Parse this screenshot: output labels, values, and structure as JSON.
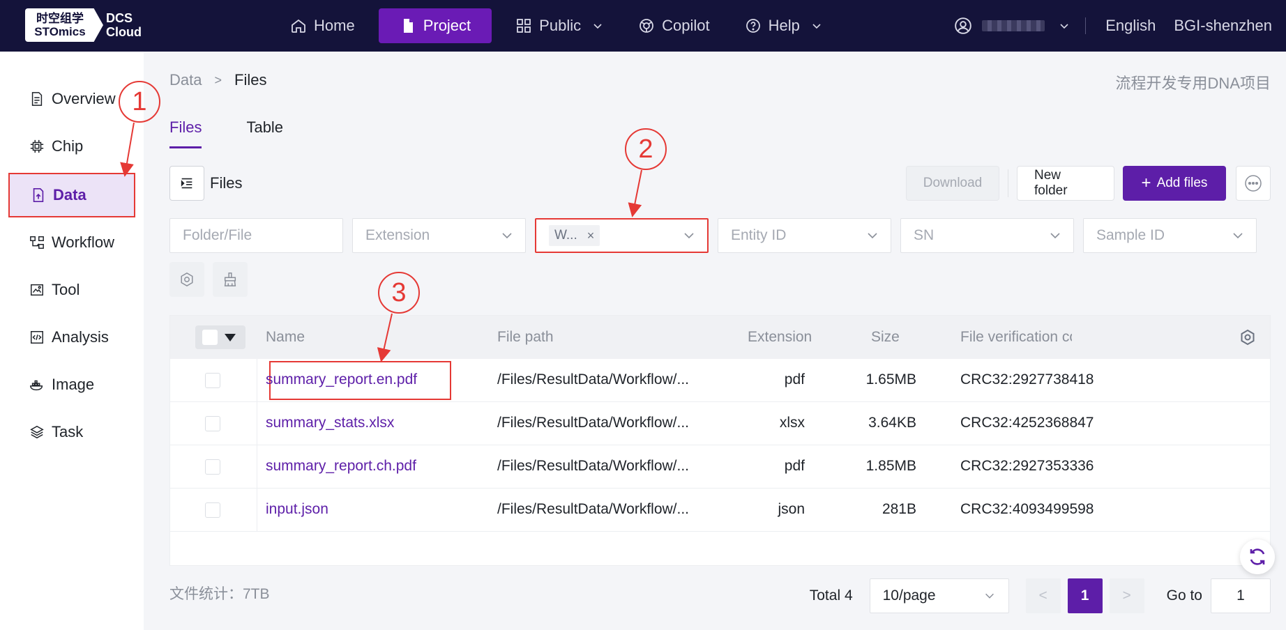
{
  "header": {
    "logo_cn": "时空组学",
    "logo_en": "STOmics",
    "logo_dcs": "DCS",
    "logo_cloud": "Cloud",
    "nav": [
      {
        "label": "Home",
        "icon": "home-icon"
      },
      {
        "label": "Project",
        "icon": "file-icon"
      },
      {
        "label": "Public",
        "icon": "grid-icon"
      },
      {
        "label": "Copilot",
        "icon": "copilot-icon"
      },
      {
        "label": "Help",
        "icon": "help-icon"
      }
    ],
    "language": "English",
    "organization": "BGI-shenzhen"
  },
  "sidebar": {
    "items": [
      {
        "label": "Overview",
        "icon": "document-icon"
      },
      {
        "label": "Chip",
        "icon": "chip-icon"
      },
      {
        "label": "Data",
        "icon": "data-icon"
      },
      {
        "label": "Workflow",
        "icon": "workflow-icon"
      },
      {
        "label": "Tool",
        "icon": "tool-icon"
      },
      {
        "label": "Analysis",
        "icon": "analysis-icon"
      },
      {
        "label": "Image",
        "icon": "image-icon"
      },
      {
        "label": "Task",
        "icon": "layers-icon"
      }
    ]
  },
  "breadcrumb": {
    "parent": "Data",
    "separator": ">",
    "current": "Files"
  },
  "project_name": "流程开发专用DNA项目",
  "tabs": [
    {
      "label": "Files"
    },
    {
      "label": "Table"
    }
  ],
  "toolbar": {
    "files_label": "Files",
    "download": "Download",
    "new_folder": "New folder",
    "add_files": "Add files",
    "plus": "+"
  },
  "filters": {
    "folder_file_placeholder": "Folder/File",
    "extension_placeholder": "Extension",
    "selected_tag": "W...",
    "tag_close": "×",
    "entity_id_placeholder": "Entity ID",
    "sn_placeholder": "SN",
    "sample_id_placeholder": "Sample ID"
  },
  "table": {
    "headers": {
      "name": "Name",
      "path": "File path",
      "extension": "Extension",
      "size": "Size",
      "checksum": "File verification cod"
    },
    "rows": [
      {
        "name": "summary_report.en.pdf",
        "path": "/Files/ResultData/Workflow/...",
        "extension": "pdf",
        "size": "1.65MB",
        "checksum": "CRC32:2927738418"
      },
      {
        "name": "summary_stats.xlsx",
        "path": "/Files/ResultData/Workflow/...",
        "extension": "xlsx",
        "size": "3.64KB",
        "checksum": "CRC32:4252368847"
      },
      {
        "name": "summary_report.ch.pdf",
        "path": "/Files/ResultData/Workflow/...",
        "extension": "pdf",
        "size": "1.85MB",
        "checksum": "CRC32:2927353336"
      },
      {
        "name": "input.json",
        "path": "/Files/ResultData/Workflow/...",
        "extension": "json",
        "size": "281B",
        "checksum": "CRC32:4093499598"
      }
    ]
  },
  "footer": {
    "stats": "文件统计：7TB",
    "total": "Total 4",
    "page_size": "10/page",
    "prev": "<",
    "current_page": "1",
    "next": ">",
    "goto_label": "Go to",
    "goto_value": "1"
  },
  "annotations": [
    "1",
    "2",
    "3"
  ],
  "colors": {
    "brand": "#5d1ea8",
    "header_bg": "#14133a",
    "annotation": "#e53935"
  }
}
